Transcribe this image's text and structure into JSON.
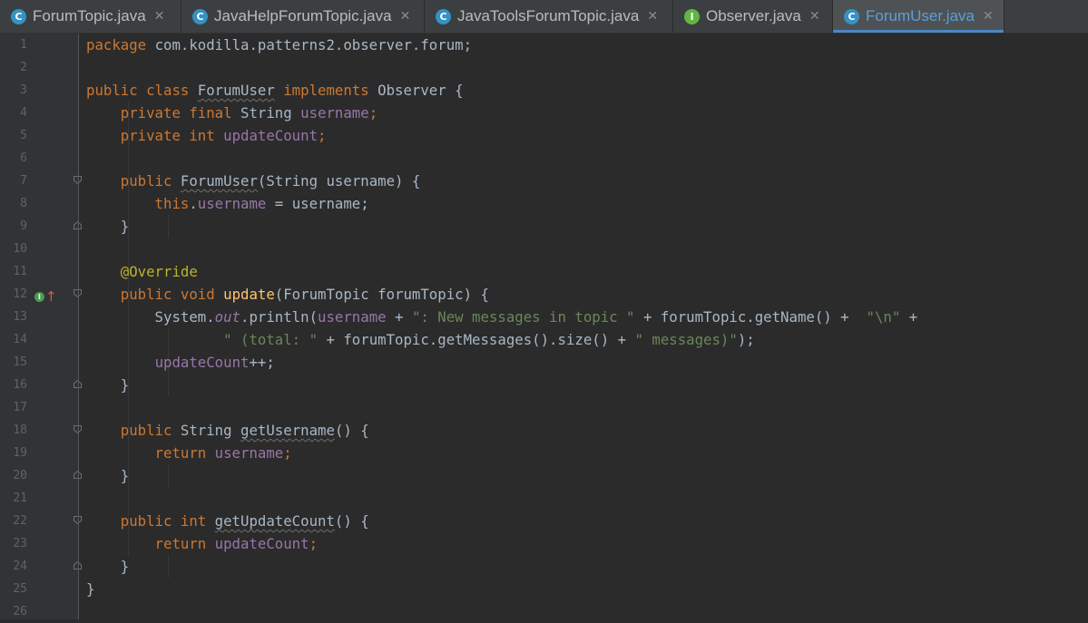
{
  "tabs": [
    {
      "icon": "C",
      "label": "ForumTopic.java",
      "close": "✕",
      "active": false
    },
    {
      "icon": "C",
      "label": "JavaHelpForumTopic.java",
      "close": "✕",
      "active": false
    },
    {
      "icon": "C",
      "label": "JavaToolsForumTopic.java",
      "close": "✕",
      "active": false
    },
    {
      "icon": "I",
      "label": "Observer.java",
      "close": "✕",
      "active": false
    },
    {
      "icon": "C",
      "label": "ForumUser.java",
      "close": "✕",
      "active": true
    }
  ],
  "line_numbers": [
    "1",
    "2",
    "3",
    "4",
    "5",
    "6",
    "7",
    "8",
    "9",
    "10",
    "11",
    "12",
    "13",
    "14",
    "15",
    "16",
    "17",
    "18",
    "19",
    "20",
    "21",
    "22",
    "23",
    "24",
    "25",
    "26"
  ],
  "code": {
    "l1": {
      "kw": "package",
      "rest": " com.kodilla.patterns2.observer.forum;"
    },
    "l3": {
      "kw1": "public class ",
      "cls": "ForumUser",
      "kw2": " implements ",
      "iface": "Observer {"
    },
    "l4": {
      "kw": "    private final ",
      "type": "String ",
      "field": "username",
      "end": ";"
    },
    "l5": {
      "kw": "    private int ",
      "field": "updateCount",
      "end": ";"
    },
    "l7": {
      "kw": "    public ",
      "name": "ForumUser",
      "rest": "(String username) {"
    },
    "l8": {
      "kw": "        this",
      "dot": ".",
      "field": "username",
      "rest": " = username;"
    },
    "l9": "    }",
    "l11": {
      "ann": "    @Override"
    },
    "l12": {
      "kw": "    public void ",
      "fn": "update",
      "rest": "(ForumTopic forumTopic) {"
    },
    "l13": {
      "pre": "        System.",
      "out": "out",
      "mid": ".println(",
      "field": "username",
      "plus": " + ",
      "s1": "\": New messages in topic \"",
      "mid2": " + forumTopic.getName() +  ",
      "s2": "\"\\n\"",
      "end": " +"
    },
    "l14": {
      "pre": "                ",
      "s1": "\" (total: \"",
      "mid": " + forumTopic.getMessages().size() + ",
      "s2": "\" messages)\"",
      "end": ");"
    },
    "l15": {
      "pre": "        ",
      "field": "updateCount",
      "end": "++;"
    },
    "l16": "    }",
    "l18": {
      "kw": "    public ",
      "type": "String ",
      "name": "getUsername",
      "rest": "() {"
    },
    "l19": {
      "kw": "        return ",
      "field": "username",
      "end": ";"
    },
    "l20": "    }",
    "l22": {
      "kw": "    public int ",
      "name": "getUpdateCount",
      "rest": "() {"
    },
    "l23": {
      "kw": "        return ",
      "field": "updateCount",
      "end": ";"
    },
    "l24": "    }",
    "l25": "}"
  },
  "gutter_marker": {
    "badge": "I",
    "arrow": "↑"
  },
  "colors": {
    "keyword": "#cc7832",
    "field": "#9876aa",
    "string": "#6a8759",
    "annotation": "#bbb529",
    "method": "#ffc66d",
    "text": "#a9b7c6",
    "active_tab": "#5e9fd7"
  }
}
